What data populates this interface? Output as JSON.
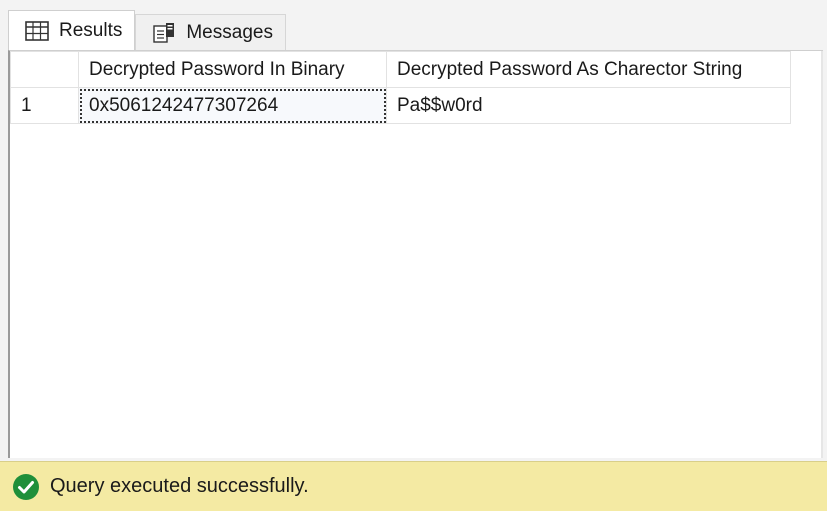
{
  "tabs": [
    {
      "label": "Results",
      "icon": "grid-icon",
      "active": true
    },
    {
      "label": "Messages",
      "icon": "messages-icon",
      "active": false
    }
  ],
  "grid": {
    "columns": [
      "Decrypted Password In Binary",
      "Decrypted Password As Charector String"
    ],
    "rows": [
      {
        "rownum": "1",
        "cells": [
          "0x5061242477307264",
          "Pa$$w0rd"
        ]
      }
    ]
  },
  "status": {
    "text": "Query executed successfully.",
    "icon": "success-check-icon",
    "color": "#f4eaa3",
    "icon_color": "#1f8f3a"
  }
}
